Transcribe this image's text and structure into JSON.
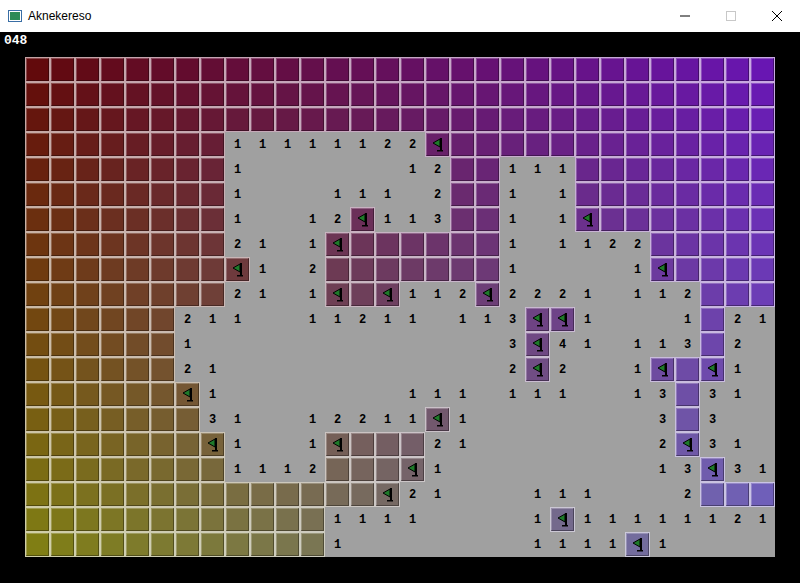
{
  "window": {
    "title": "Aknekereso"
  },
  "counter": "048",
  "legend": {
    "covered": "c",
    "flagged": "f",
    "open_blank": ""
  },
  "board": [
    [
      "c",
      "c",
      "c",
      "c",
      "c",
      "c",
      "c",
      "c",
      "c",
      "c",
      "c",
      "c",
      "c",
      "c",
      "c",
      "c",
      "c",
      "c",
      "c",
      "c",
      "c",
      "c",
      "c",
      "c",
      "c",
      "c",
      "c",
      "c",
      "c",
      "c"
    ],
    [
      "c",
      "c",
      "c",
      "c",
      "c",
      "c",
      "c",
      "c",
      "c",
      "c",
      "c",
      "c",
      "c",
      "c",
      "c",
      "c",
      "c",
      "c",
      "c",
      "c",
      "c",
      "c",
      "c",
      "c",
      "c",
      "c",
      "c",
      "c",
      "c",
      "c"
    ],
    [
      "c",
      "c",
      "c",
      "c",
      "c",
      "c",
      "c",
      "c",
      "c",
      "c",
      "c",
      "c",
      "c",
      "c",
      "c",
      "c",
      "c",
      "c",
      "c",
      "c",
      "c",
      "c",
      "c",
      "c",
      "c",
      "c",
      "c",
      "c",
      "c",
      "c"
    ],
    [
      "c",
      "c",
      "c",
      "c",
      "c",
      "c",
      "c",
      "c",
      "1",
      "1",
      "1",
      "1",
      "1",
      "1",
      "2",
      "2",
      "f",
      "c",
      "c",
      "c",
      "c",
      "c",
      "c",
      "c",
      "c",
      "c",
      "c",
      "c",
      "c",
      "c"
    ],
    [
      "c",
      "c",
      "c",
      "c",
      "c",
      "c",
      "c",
      "c",
      "1",
      "",
      "",
      "",
      "",
      "",
      "",
      "1",
      "2",
      "c",
      "c",
      "1",
      "1",
      "1",
      "c",
      "c",
      "c",
      "c",
      "c",
      "c",
      "c",
      "c"
    ],
    [
      "c",
      "c",
      "c",
      "c",
      "c",
      "c",
      "c",
      "c",
      "1",
      "",
      "",
      "",
      "1",
      "1",
      "1",
      "",
      "2",
      "c",
      "c",
      "1",
      "",
      "1",
      "c",
      "c",
      "c",
      "c",
      "c",
      "c",
      "c",
      "c"
    ],
    [
      "c",
      "c",
      "c",
      "c",
      "c",
      "c",
      "c",
      "c",
      "1",
      "",
      "",
      "1",
      "2",
      "f",
      "1",
      "1",
      "3",
      "c",
      "c",
      "1",
      "",
      "1",
      "f",
      "c",
      "c",
      "c",
      "c",
      "c",
      "c",
      "c"
    ],
    [
      "c",
      "c",
      "c",
      "c",
      "c",
      "c",
      "c",
      "c",
      "2",
      "1",
      "",
      "1",
      "f",
      "c",
      "c",
      "c",
      "c",
      "c",
      "c",
      "1",
      "",
      "1",
      "1",
      "2",
      "2",
      "c",
      "c",
      "c",
      "c",
      "c"
    ],
    [
      "c",
      "c",
      "c",
      "c",
      "c",
      "c",
      "c",
      "c",
      "f",
      "1",
      "",
      "2",
      "c",
      "c",
      "c",
      "c",
      "c",
      "c",
      "c",
      "1",
      "",
      "",
      "",
      "",
      "1",
      "f",
      "c",
      "c",
      "c",
      "c"
    ],
    [
      "c",
      "c",
      "c",
      "c",
      "c",
      "c",
      "c",
      "c",
      "2",
      "1",
      "",
      "1",
      "f",
      "c",
      "f",
      "1",
      "1",
      "2",
      "f",
      "2",
      "2",
      "2",
      "1",
      "",
      "1",
      "1",
      "2",
      "c",
      "c",
      "c"
    ],
    [
      "c",
      "c",
      "c",
      "c",
      "c",
      "c",
      "2",
      "1",
      "1",
      "",
      "",
      "1",
      "1",
      "2",
      "1",
      "1",
      "",
      "1",
      "1",
      "3",
      "f",
      "f",
      "1",
      "",
      "",
      "",
      "1",
      "c",
      "2",
      "1"
    ],
    [
      "c",
      "c",
      "c",
      "c",
      "c",
      "c",
      "1",
      "",
      "",
      "",
      "",
      "",
      "",
      "",
      "",
      "",
      "",
      "",
      "",
      "3",
      "f",
      "4",
      "1",
      "",
      "1",
      "1",
      "3",
      "c",
      "2",
      ""
    ],
    [
      "c",
      "c",
      "c",
      "c",
      "c",
      "c",
      "2",
      "1",
      "",
      "",
      "",
      "",
      "",
      "",
      "",
      "",
      "",
      "",
      "",
      "2",
      "f",
      "2",
      "",
      "",
      "1",
      "f",
      "c",
      "f",
      "1",
      ""
    ],
    [
      "c",
      "c",
      "c",
      "c",
      "c",
      "c",
      "f",
      "1",
      "",
      "",
      "",
      "",
      "",
      "",
      "",
      "1",
      "1",
      "1",
      "",
      "1",
      "1",
      "1",
      "",
      "",
      "1",
      "3",
      "c",
      "3",
      "1",
      ""
    ],
    [
      "c",
      "c",
      "c",
      "c",
      "c",
      "c",
      "c",
      "3",
      "1",
      "",
      "",
      "1",
      "2",
      "2",
      "1",
      "1",
      "f",
      "1",
      "",
      "",
      "",
      "",
      "",
      "",
      "",
      "3",
      "c",
      "3",
      "",
      ""
    ],
    [
      "c",
      "c",
      "c",
      "c",
      "c",
      "c",
      "c",
      "f",
      "1",
      "",
      "",
      "1",
      "f",
      "c",
      "c",
      "c",
      "2",
      "1",
      "",
      "",
      "",
      "",
      "",
      "",
      "",
      "2",
      "f",
      "3",
      "1",
      ""
    ],
    [
      "c",
      "c",
      "c",
      "c",
      "c",
      "c",
      "c",
      "c",
      "1",
      "1",
      "1",
      "2",
      "c",
      "c",
      "c",
      "f",
      "1",
      "",
      "",
      "",
      "",
      "",
      "",
      "",
      "",
      "1",
      "3",
      "f",
      "3",
      "1"
    ],
    [
      "c",
      "c",
      "c",
      "c",
      "c",
      "c",
      "c",
      "c",
      "c",
      "c",
      "c",
      "c",
      "c",
      "c",
      "f",
      "2",
      "1",
      "",
      "",
      "",
      "1",
      "1",
      "1",
      "",
      "",
      "",
      "2",
      "c",
      "c",
      "c"
    ],
    [
      "c",
      "c",
      "c",
      "c",
      "c",
      "c",
      "c",
      "c",
      "c",
      "c",
      "c",
      "c",
      "1",
      "1",
      "1",
      "1",
      "",
      "",
      "",
      "",
      "1",
      "f",
      "1",
      "1",
      "1",
      "1",
      "1",
      "1",
      "2",
      "1"
    ],
    [
      "c",
      "c",
      "c",
      "c",
      "c",
      "c",
      "c",
      "c",
      "c",
      "c",
      "c",
      "c",
      "1",
      "",
      "",
      "",
      "",
      "",
      "",
      "",
      "1",
      "1",
      "1",
      "1",
      "f",
      "1",
      "",
      "",
      "",
      ""
    ]
  ]
}
